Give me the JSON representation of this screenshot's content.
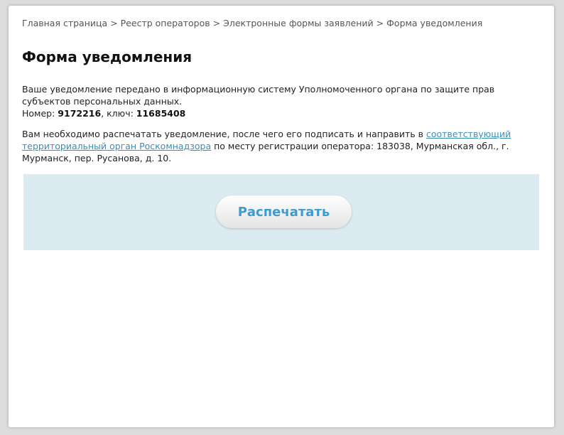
{
  "breadcrumb": {
    "items": [
      "Главная страница",
      "Реестр операторов",
      "Электронные формы заявлений",
      "Форма уведомления"
    ],
    "separator": ">"
  },
  "page": {
    "title": "Форма уведомления"
  },
  "notice": {
    "line1": "Ваше уведомление передано в информационную систему Уполномоченного органа по защите прав субъектов персональных данных.",
    "number_label": "Номер: ",
    "number_value": "9172216",
    "key_label": ", ключ: ",
    "key_value": "11685408"
  },
  "instructions": {
    "text_before": "Вам необходимо распечатать уведомление, после чего его подписать и направить в ",
    "link_text": "соответствующий территориальный орган Роскомнадзора",
    "text_after": " по месту регистрации оператора: 183038, Мурманская обл., г. Мурманск, пер. Русанова, д. 10."
  },
  "print": {
    "button_label": "Распечатать"
  },
  "colors": {
    "link": "#3a8fb7",
    "button_text": "#3d9ccf",
    "panel_bg": "#dbebf1"
  }
}
